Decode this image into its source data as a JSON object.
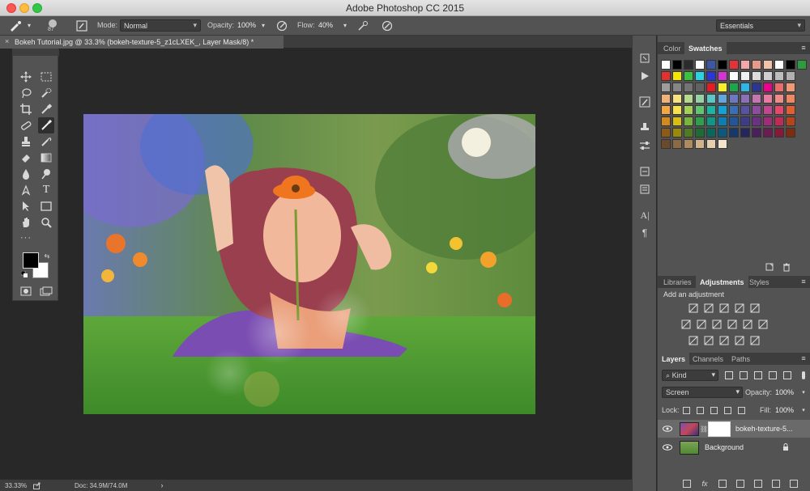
{
  "window": {
    "title": "Adobe Photoshop CC 2015"
  },
  "options_bar": {
    "brush_size": "87",
    "mode_label": "Mode:",
    "mode_value": "Normal",
    "opacity_label": "Opacity:",
    "opacity_value": "100%",
    "flow_label": "Flow:",
    "flow_value": "40%",
    "workspace_value": "Essentials"
  },
  "document_tab": {
    "title": "Bokeh Tutorial.jpg @ 33.3% (bokeh-texture-5_z1cLXEK_, Layer Mask/8) *"
  },
  "right_panel": {
    "top_tabs": [
      "Color",
      "Swatches"
    ],
    "top_active": "Swatches",
    "adjust_tabs": [
      "Libraries",
      "Adjustments",
      "Styles"
    ],
    "adjust_active": "Adjustments",
    "add_adjustment_label": "Add an adjustment",
    "layer_tabs": [
      "Layers",
      "Channels",
      "Paths"
    ],
    "layer_active": "Layers",
    "kind_label": "Kind",
    "blend_mode": "Screen",
    "opacity_label": "Opacity:",
    "opacity_value": "100%",
    "lock_label": "Lock:",
    "fill_label": "Fill:",
    "fill_value": "100%",
    "layers": [
      {
        "name": "bokeh-texture-5..."
      },
      {
        "name": "Background"
      }
    ]
  },
  "status_bar": {
    "zoom": "33.33%",
    "doc_info": "Doc: 34.9M/74.0M"
  },
  "colors": {
    "panel_bg": "#535353",
    "panel_dark": "#3d3d3d",
    "canvas_bg": "#282828",
    "accent_selected_layer": "#6a6a6a"
  },
  "swatches_rows": [
    [
      "#ffffff",
      "#000000",
      "#2b2b2b",
      "#ffffff",
      "#3b57a6",
      "#000000",
      "#e53238",
      "#f5a6a6",
      "#e89a8a",
      "#f3c0aa",
      "#ffffff",
      "#000000",
      "#2d9c3a"
    ],
    [
      "#e63030",
      "#f6e600",
      "#38c23d",
      "#2ad2e3",
      "#2a37d8",
      "#d434d3",
      "#ffffff",
      "#f1f1f1",
      "#dddddd",
      "#cfcfcf",
      "#bdbdbd",
      "#b0b0b0"
    ],
    [
      "#9d9d9d",
      "#868686",
      "#747474",
      "#626262",
      "#e31d23",
      "#f7ee2a",
      "#1da64b",
      "#2eb6e8",
      "#2b3592",
      "#ec008c",
      "#ee6b6b",
      "#ef9a73"
    ],
    [
      "#f2b179",
      "#f7e27d",
      "#b6d98e",
      "#94d1a5",
      "#5bc7c7",
      "#61a6dd",
      "#6c78c1",
      "#8b6fb7",
      "#c575b1",
      "#ea7aa2",
      "#f18b8a",
      "#ef8761"
    ],
    [
      "#f4a640",
      "#f9e14c",
      "#a6d157",
      "#61c46f",
      "#1bb6a3",
      "#14a0d8",
      "#3a6fb7",
      "#5951a3",
      "#8e4b9f",
      "#c3458f",
      "#e7476a",
      "#e25d30"
    ],
    [
      "#d6881a",
      "#d7bf12",
      "#79b53a",
      "#2e9f4a",
      "#0e9686",
      "#0b7fb4",
      "#23559b",
      "#3d3b8a",
      "#6c3185",
      "#9f2b79",
      "#c02a55",
      "#b5441a"
    ],
    [
      "#8e5a14",
      "#998a0c",
      "#4f7b23",
      "#1d6c33",
      "#0b665c",
      "#0c587e",
      "#17386c",
      "#26265e",
      "#49205c",
      "#6d1c53",
      "#84193a",
      "#7d2d0f"
    ],
    [
      "#6b4a2c",
      "#8c6a43",
      "#b08a5e",
      "#d2b28a",
      "#e6cfae",
      "#f2e4cd"
    ]
  ]
}
